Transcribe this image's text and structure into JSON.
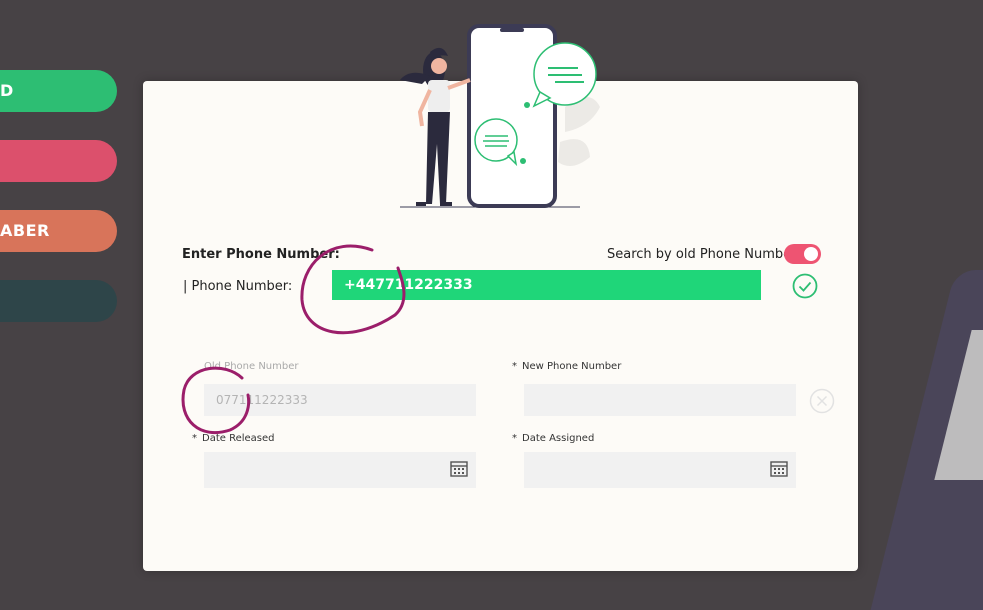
{
  "sidebar": {
    "buttons": [
      {
        "label": "D",
        "color": "#2dbe73"
      },
      {
        "label": "",
        "color": "#dc506c"
      },
      {
        "label": "ABER",
        "color": "#d8745a"
      },
      {
        "label": "",
        "color": "#2e4549"
      }
    ]
  },
  "form": {
    "enter_phone_label": "Enter Phone Number:",
    "phone_number_label": "| Phone Number:",
    "phone_number_value": "+447711222333",
    "search_old_label": "Search by old Phone Number",
    "search_old_enabled": true,
    "old_phone": {
      "label": "Old Phone Number",
      "value": "077111222333"
    },
    "new_phone": {
      "required": "*",
      "label": "New Phone Number",
      "value": ""
    },
    "date_released": {
      "required": "*",
      "label": "Date Released",
      "value": ""
    },
    "date_assigned": {
      "required": "*",
      "label": "Date Assigned",
      "value": ""
    }
  },
  "colors": {
    "accent_green": "#1fd679",
    "toggle_on": "#ee5472",
    "annotation": "#9b1e6a"
  },
  "icons": [
    "check-circle-icon",
    "calendar-icon",
    "clear-icon",
    "phone-illustration"
  ]
}
